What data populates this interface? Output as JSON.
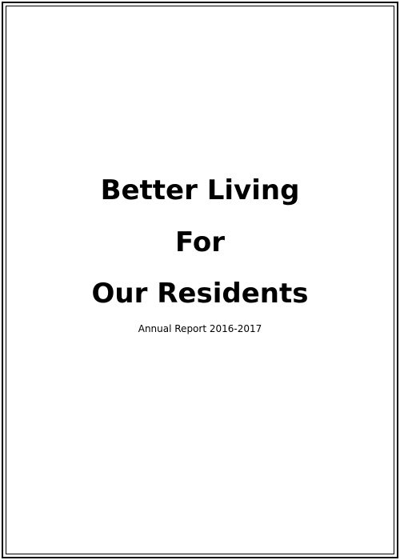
{
  "cover": {
    "title_lines": [
      "Better Living",
      "For",
      "Our Residents"
    ],
    "subtitle": "Annual Report 2016-2017"
  }
}
